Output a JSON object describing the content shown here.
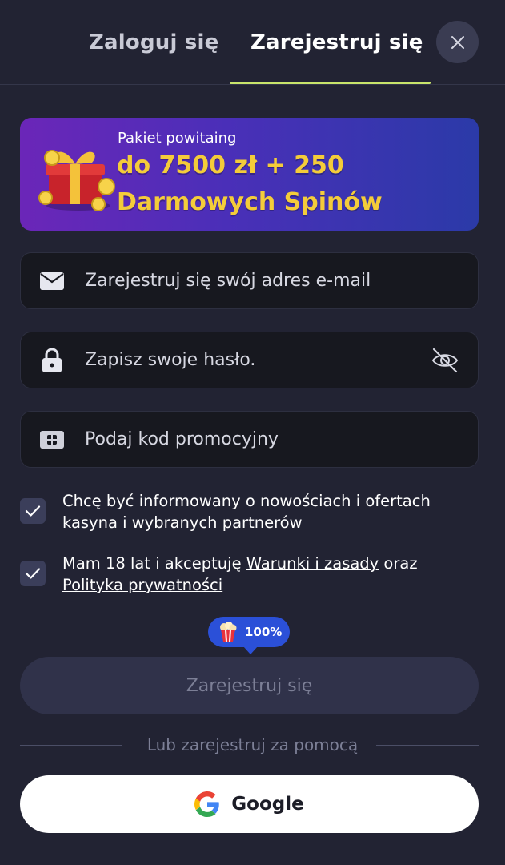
{
  "tabs": {
    "login": "Zaloguj się",
    "register": "Zarejestruj się",
    "active": "register"
  },
  "promo": {
    "label": "Pakiet powitaing",
    "line1": "do 7500 zł + 250",
    "line2": "Darmowych Spinów"
  },
  "fields": {
    "email_placeholder": "Zarejestruj się swój adres e-mail",
    "password_placeholder": "Zapisz swoje hasło.",
    "promo_placeholder": "Podaj kod promocyjny"
  },
  "checks": {
    "newsletter": {
      "text": "Chcę być informowany o nowościach i ofertach kasyna i wybranych partnerów",
      "checked": true
    },
    "terms": {
      "prefix": "Mam 18 lat i akceptuję ",
      "terms_link": "Warunki i zasady",
      "middle": " oraz ",
      "privacy_link": "Polityka prywatności",
      "checked": true
    }
  },
  "badge": {
    "text": "100%"
  },
  "submit": {
    "label": "Zarejestruj się"
  },
  "divider": {
    "text": "Lub zarejestruj za pomocą"
  },
  "google": {
    "label": "Google"
  },
  "colors": {
    "accent_underline": "#c9e56b",
    "promo_gold": "#f4cc3a",
    "badge_blue": "#2b50d8"
  },
  "icons": [
    "close-icon",
    "gift-icon",
    "mail-icon",
    "lock-icon",
    "eye-off-icon",
    "ticket-icon",
    "check-icon",
    "popcorn-icon",
    "google-icon"
  ]
}
